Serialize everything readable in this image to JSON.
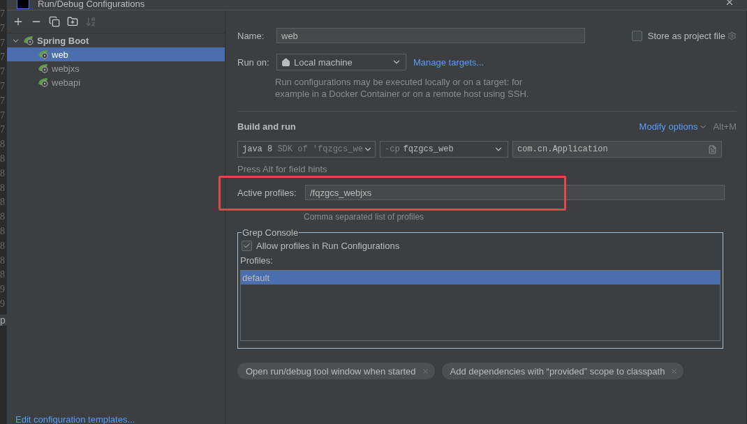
{
  "window": {
    "title": "Run/Debug Configurations"
  },
  "editor_gutter": {
    "line_numbers": [
      "7",
      "7",
      "7",
      "7",
      "7",
      "7",
      "7",
      "7",
      "7",
      "8",
      "8",
      "8",
      "8",
      "8",
      "8",
      "8",
      "8",
      "8",
      "8",
      "9",
      "9"
    ],
    "fragment": "p"
  },
  "toolbar": [
    {
      "kind": "add",
      "disabled": false
    },
    {
      "kind": "remove",
      "disabled": false
    },
    {
      "kind": "copy",
      "disabled": false
    },
    {
      "kind": "folder",
      "disabled": false
    },
    {
      "kind": "sort",
      "disabled": true
    }
  ],
  "tree": {
    "label": "Spring Boot",
    "expanded": true,
    "children": [
      {
        "label": "web",
        "selected": true
      },
      {
        "label": "webjxs",
        "selected": false
      },
      {
        "label": "webapi",
        "selected": false
      }
    ]
  },
  "edit_templates_link": "Edit configuration templates...",
  "name": {
    "label": "Name:",
    "value": "web"
  },
  "store_as_project_file": {
    "label": "Store as project file",
    "checked": false
  },
  "run_on": {
    "label": "Run on:",
    "value": "Local machine",
    "link": "Manage targets...",
    "hint": "Run configurations may be executed locally or on a target: for example in a Docker Container or on a remote host using SSH."
  },
  "build_and_run": {
    "title": "Build and run",
    "modify_options": "Modify options",
    "shortcut": "Alt+M",
    "jdk": {
      "value": "java 8",
      "hint": "SDK of 'fqzgcs_we"
    },
    "classpath": {
      "prefix": "-cp",
      "value": "fqzgcs_web"
    },
    "main_class": "com.cn.Application",
    "field_hints": "Press Alt for field hints"
  },
  "active_profiles": {
    "label": "Active profiles:",
    "value": "/fqzgcs_webjxs",
    "hint": "Comma separated list of profiles",
    "highlighted": true
  },
  "grep_console": {
    "title": "Grep Console",
    "allow_profiles": {
      "label": "Allow profiles in Run Configurations",
      "checked": true
    },
    "profiles_label": "Profiles:",
    "profiles": [
      {
        "label": "default",
        "selected": true
      }
    ]
  },
  "option_chips": [
    "Open run/debug tool window when started",
    "Add dependencies with “provided” scope to classpath"
  ]
}
